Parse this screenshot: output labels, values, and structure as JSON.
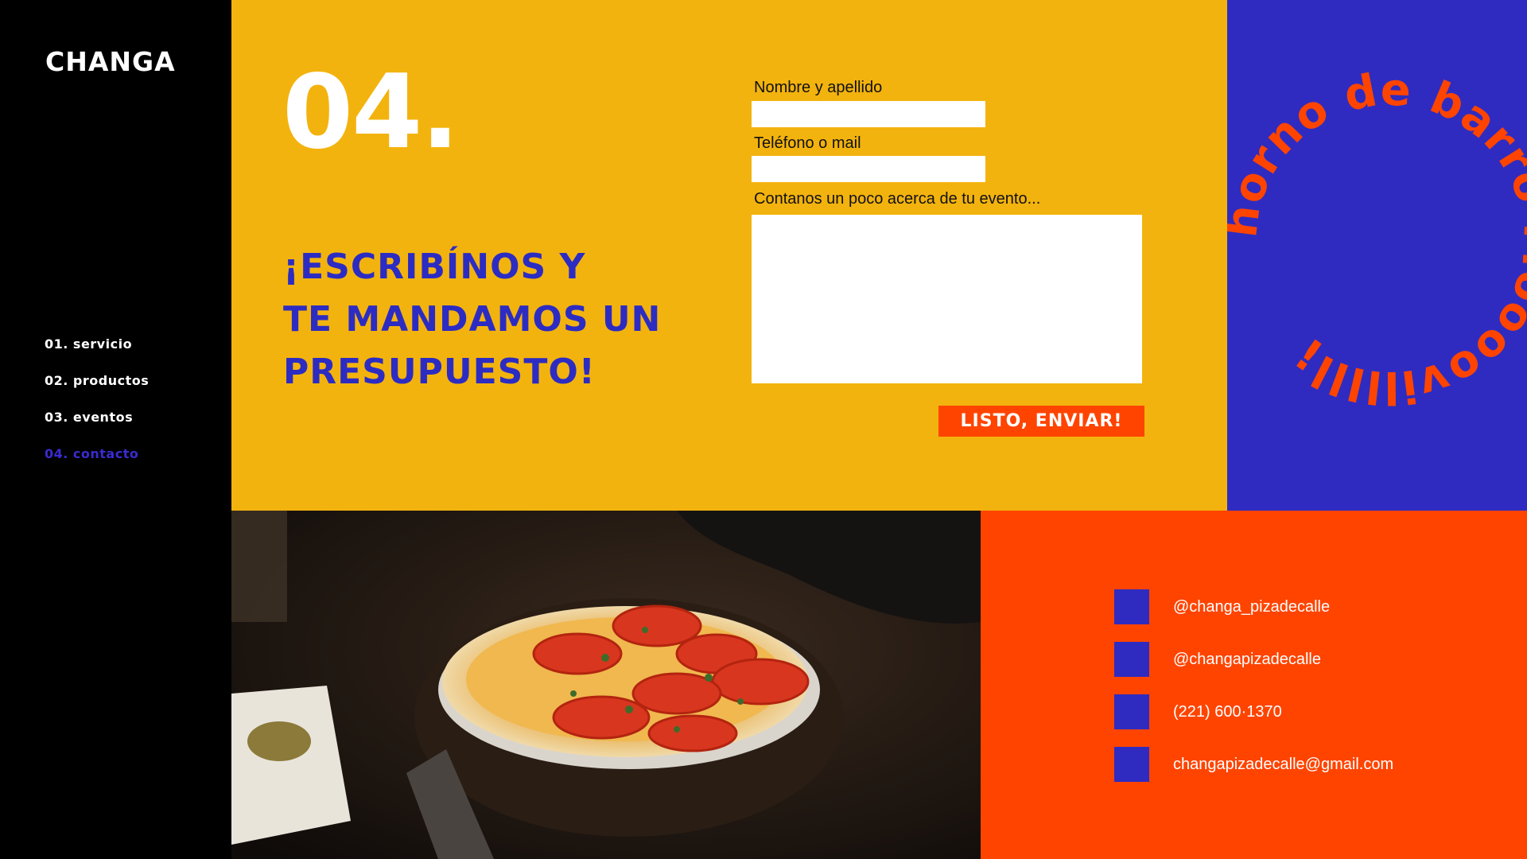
{
  "brand": "CHANGA",
  "nav": [
    {
      "label": "01. servicio"
    },
    {
      "label": "02. productos"
    },
    {
      "label": "03. eventos"
    },
    {
      "label": "04. contacto"
    }
  ],
  "section_number": "04.",
  "headline": [
    "¡ESCRIBÍNOS Y",
    "TE MANDAMOS UN",
    "PRESUPUESTO!"
  ],
  "form": {
    "name_label": "Nombre y apellido",
    "name_value": "",
    "contact_label": "Teléfono o mail",
    "contact_value": "",
    "message_label": "Contanos un poco acerca de tu evento...",
    "message_value": "",
    "submit_label": "LISTO, ENVIAR!"
  },
  "circle_text": "horno de barro Moooovilllll¡",
  "contacts": [
    {
      "icon": "instagram-icon",
      "value": "@changa_pizadecalle"
    },
    {
      "icon": "facebook-icon",
      "value": "@changapizadecalle"
    },
    {
      "icon": "phone-icon",
      "value": "(221) 600·1370"
    },
    {
      "icon": "mail-icon",
      "value": "changapizadecalle@gmail.com"
    }
  ],
  "colors": {
    "yellow": "#f3b30e",
    "blue": "#2f2bc0",
    "orange": "#ff4400",
    "black": "#000000"
  }
}
